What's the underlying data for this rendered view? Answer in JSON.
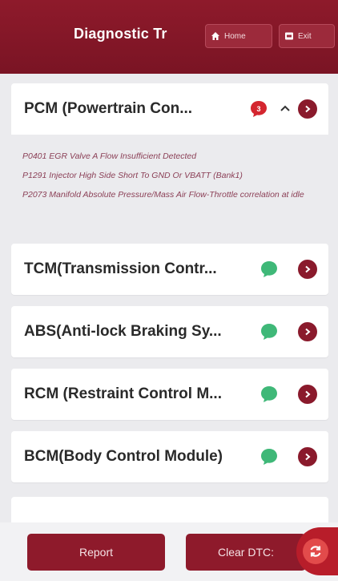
{
  "header": {
    "title": "Diagnostic Tr",
    "home_label": "Home",
    "exit_label": "Exit",
    "color": "#8e1a2b"
  },
  "modules": [
    {
      "name": "PCM (Powertrain Con...",
      "status": "error",
      "badge_count": "3",
      "expanded": true,
      "dtcs": [
        "P0401 EGR Valve A Flow Insufficient Detected",
        "P1291 Injector High Side Short To GND Or VBATT (Bank1)",
        "P2073 Manifold Absolute Pressure/Mass Air Flow-Throttle correlation at idle"
      ]
    },
    {
      "name": "TCM(Transmission Contr...",
      "status": "ok",
      "expanded": false
    },
    {
      "name": "ABS(Anti-lock Braking Sy...",
      "status": "ok",
      "expanded": false
    },
    {
      "name": "RCM (Restraint Control M...",
      "status": "ok",
      "expanded": false
    },
    {
      "name": "BCM(Body Control Module)",
      "status": "ok",
      "expanded": false
    }
  ],
  "colors": {
    "error_badge": "#d4262f",
    "ok_badge": "#3fb878",
    "arrow": "#8a1a2c",
    "dtc_text": "#8b3f56"
  },
  "footer": {
    "report_label": "Report",
    "clear_label": "Clear DTC:"
  },
  "icons": {
    "home": "home-icon",
    "exit": "exit-icon",
    "error_badge": "error-message-icon",
    "ok_badge": "ok-message-icon",
    "arrow": "chevron-right-icon",
    "caret": "chevron-up-icon",
    "fab": "refresh-icon"
  }
}
